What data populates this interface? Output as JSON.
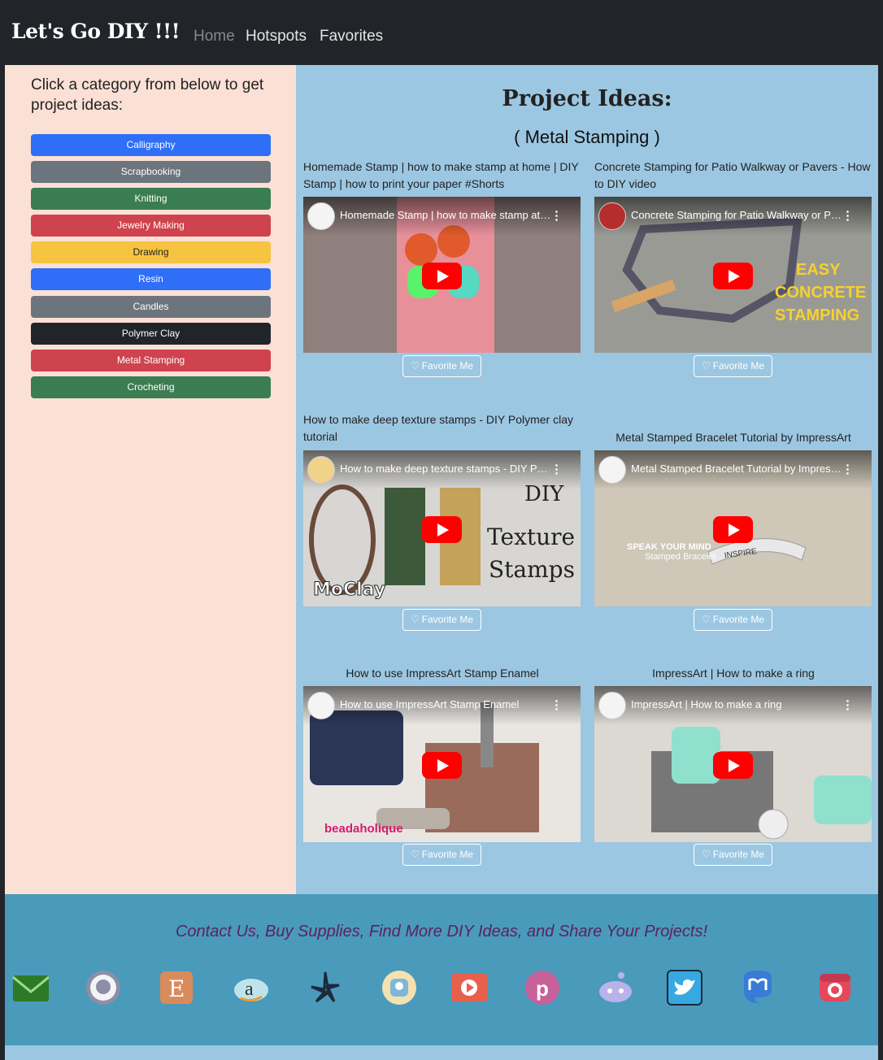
{
  "brand": "Let's Go DIY !!!",
  "nav": [
    {
      "label": "Home",
      "active": true
    },
    {
      "label": "Hotspots",
      "active": false
    },
    {
      "label": "Favorites",
      "active": false
    }
  ],
  "sidebar": {
    "title": "Click a category from below to get project ideas:",
    "categories": [
      {
        "label": "Calligraphy",
        "color": "#2f6ef6"
      },
      {
        "label": "Scrapbooking",
        "color": "#6c757d"
      },
      {
        "label": "Knitting",
        "color": "#3b7d52"
      },
      {
        "label": "Jewelry Making",
        "color": "#cf434e"
      },
      {
        "label": "Drawing",
        "color": "#f6c440"
      },
      {
        "label": "Resin",
        "color": "#2f6ef6"
      },
      {
        "label": "Candles",
        "color": "#6c757d"
      },
      {
        "label": "Polymer Clay",
        "color": "#212529"
      },
      {
        "label": "Metal Stamping",
        "color": "#cf434e"
      },
      {
        "label": "Crocheting",
        "color": "#3b7d52"
      }
    ]
  },
  "main": {
    "heading": "Project Ideas:",
    "subheading": "( Metal Stamping )",
    "favorite_label": "Favorite Me",
    "videos": [
      {
        "title": "Homemade Stamp | how to make stamp at home | DIY Stamp | how to print your paper #Shorts",
        "player_title": "Homemade Stamp | how to make stamp at home | DIY Stamp",
        "thumb_color": "#e58f9a"
      },
      {
        "title": "Concrete Stamping for Patio Walkway or Pavers - How to DIY video",
        "player_title": "Concrete Stamping for Patio Walkway or Pavers - How to DIY",
        "thumb_color": "#9a9a94",
        "overlay_text": "EASY CONCRETE STAMPING"
      },
      {
        "title": "How to make deep texture stamps - DIY Polymer clay tutorial",
        "player_title": "How to make deep texture stamps - DIY Polymer clay tutorial",
        "thumb_color": "#d8d6d3",
        "overlay_text": "DIY Texture Stamps",
        "overlay_logo": "MoClay"
      },
      {
        "title": "Metal Stamped Bracelet Tutorial by ImpressArt",
        "player_title": "Metal Stamped Bracelet Tutorial by ImpressArt",
        "thumb_color": "#cfc7b8",
        "overlay_text": "SPEAK YOUR MIND",
        "overlay_sub": "Stamped Bracelet",
        "overlay_word": "INSPIRE"
      },
      {
        "title": "How to use ImpressArt Stamp Enamel",
        "player_title": "How to use ImpressArt Stamp Enamel",
        "thumb_color": "#e9e6e2",
        "overlay_logo": "beadaholique"
      },
      {
        "title": "ImpressArt | How to make a ring",
        "player_title": "ImpressArt | How to make a ring",
        "thumb_color": "#dcd8d2"
      }
    ]
  },
  "footer": {
    "text": "Contact Us, Buy Supplies, Find More DIY Ideas, and Share Your Projects!",
    "icons": [
      "mail-icon",
      "github-icon",
      "etsy-icon",
      "amazon-icon",
      "yelp-icon",
      "snapchat-icon",
      "youtube-icon",
      "pinterest-icon",
      "reddit-icon",
      "twitter-icon",
      "mastodon-icon",
      "instagram-icon"
    ]
  }
}
